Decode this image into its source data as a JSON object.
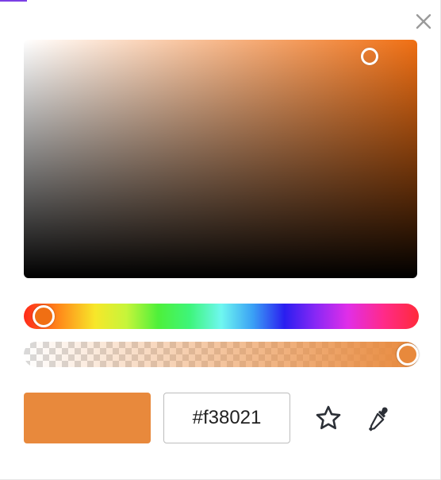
{
  "picker": {
    "hex_value": "#f38021",
    "hue_color": "#f06f13",
    "selected_color": "#e8893c",
    "accent_color": "#7b3fe4",
    "saturation": 0.88,
    "brightness": 0.93,
    "hue_position": 0.05,
    "alpha": 1.0
  },
  "icons": {
    "close": "close-icon",
    "favorite": "star-icon",
    "eyedropper": "eyedropper-icon"
  }
}
